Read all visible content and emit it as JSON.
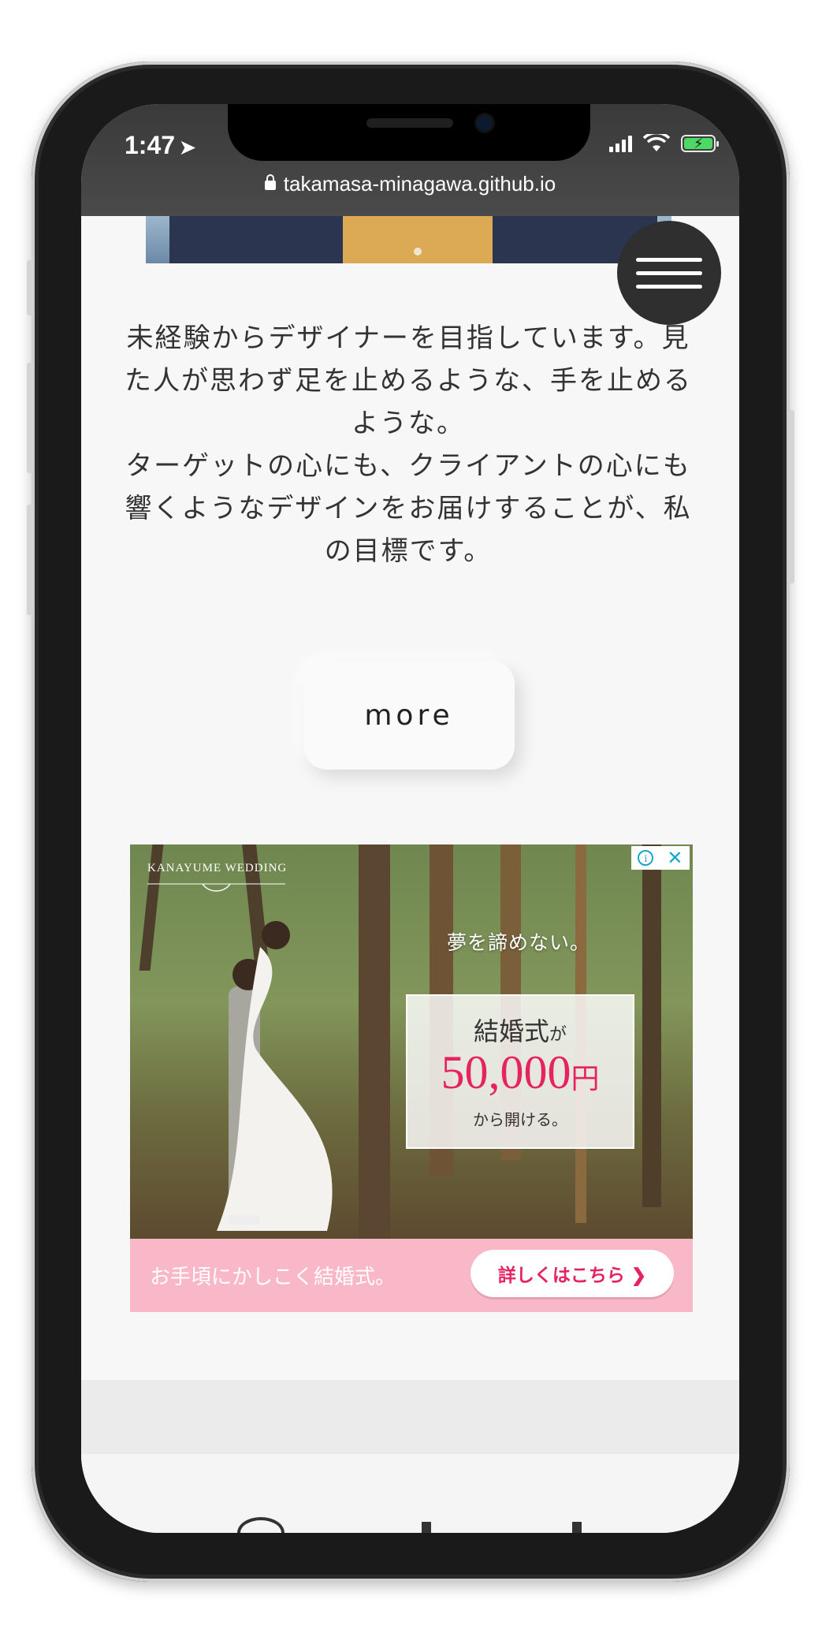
{
  "status_bar": {
    "time": "1:47",
    "location_icon": "location-arrow-icon",
    "url": "takamasa-minagawa.github.io"
  },
  "intro": {
    "lines": [
      "未経験からデザイナーを目指しています。見た人が思わず足を止めるような、手を止めるような。",
      "ターゲットの心にも、クライアントの心にも響くようなデザインをお届けすることが、私の目標です。"
    ]
  },
  "more_button": {
    "label": "more"
  },
  "ad": {
    "brand": "KANAYUME WEDDING",
    "tagline": "夢を諦めない。",
    "card": {
      "line1": "結婚式",
      "line1_suffix": "が",
      "price": "50,000",
      "price_unit": "円",
      "line3": "から開ける。"
    },
    "footer_text": "お手頃にかしこく結婚式。",
    "cta": "詳しくはこちら ❯",
    "choices_info": "i",
    "choices_close": "✕"
  },
  "colors": {
    "accent_pink": "#e5245f",
    "footer_pink": "#f8b8c8",
    "menu_bg": "#2f2f2f"
  }
}
